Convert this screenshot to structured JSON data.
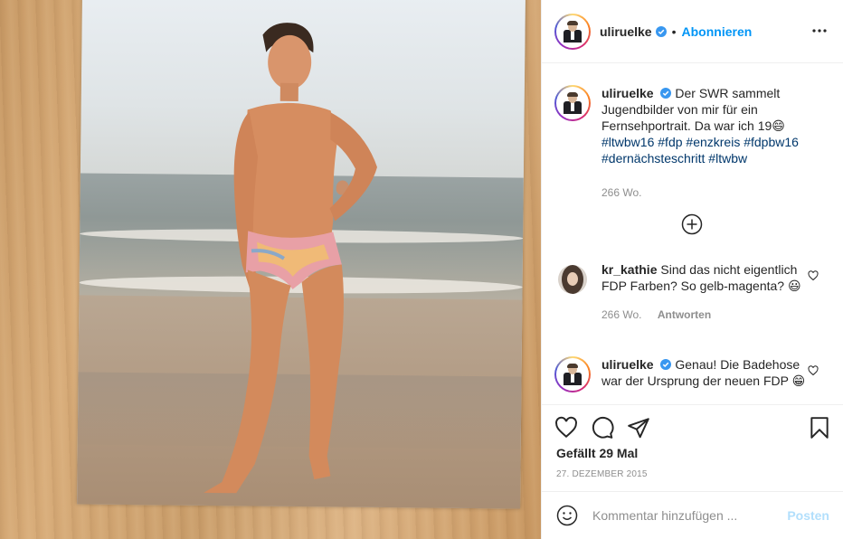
{
  "post": {
    "username": "uliruelke",
    "follow_label": "Abonnieren",
    "separator": "•",
    "caption_text": "Der SWR sammelt Jugendbilder von mir für ein Fernsehportrait. Da war ich 19😄",
    "caption_tags": [
      "#ltwbw16",
      "#fdp",
      "#enzkreis",
      "#fdpbw16",
      "#dernächsteschritt",
      "#ltwbw"
    ],
    "caption_age": "266 Wo.",
    "likes_label": "Gefällt 29 Mal",
    "date_label": "27. DEZEMBER 2015"
  },
  "comments": [
    {
      "username": "kr_kathie",
      "text": "Sind das nicht eigentlich FDP Farben? So gelb-magenta? 😃",
      "age": "266 Wo.",
      "reply_label": "Antworten"
    },
    {
      "username": "uliruelke",
      "text": "Genau! Die Badehose war der Ursprung der neuen FDP 😁"
    }
  ],
  "composer": {
    "placeholder": "Kommentar hinzufügen ...",
    "post_label": "Posten"
  },
  "colors": {
    "accent": "#0095f6",
    "hashtag": "#00376b",
    "muted": "#8e8e8e",
    "post_disabled": "#b2dffc"
  },
  "icons": [
    "verified-badge-icon",
    "more-options-icon",
    "load-more-icon",
    "heart-icon",
    "comment-icon",
    "share-icon",
    "save-icon",
    "emoji-icon"
  ]
}
